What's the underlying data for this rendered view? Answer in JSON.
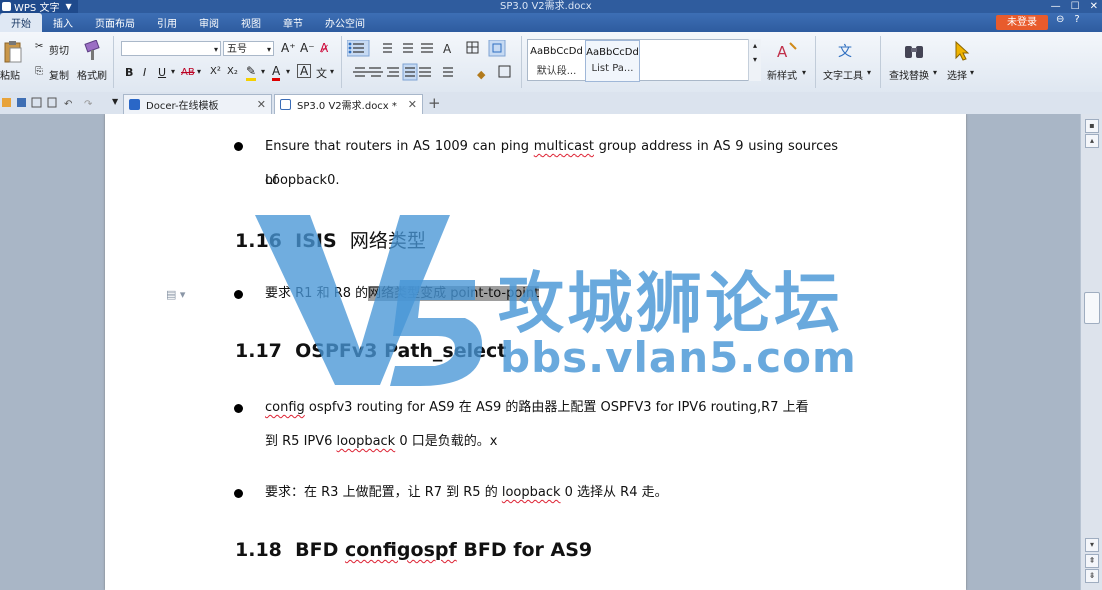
{
  "window": {
    "app_name": "WPS 文字",
    "doc_title": "SP3.0 V2需求.docx",
    "controls": [
      "—",
      "☐",
      "✕"
    ]
  },
  "menu": {
    "tabs": [
      "开始",
      "插入",
      "页面布局",
      "引用",
      "审阅",
      "视图",
      "章节",
      "办公空间"
    ],
    "active": "开始",
    "login_label": "未登录",
    "right_icons": [
      "⊖",
      "?"
    ]
  },
  "ribbon": {
    "paste": "粘贴",
    "cut": "剪切",
    "copy": "复制",
    "format_painter": "格式刷",
    "font_name": "",
    "font_size": "五号",
    "grow_font": "A⁺",
    "shrink_font": "A⁻",
    "clear_format": "A̷",
    "bold": "B",
    "italic": "I",
    "underline": "U",
    "strike": "AB",
    "superscript": "X²",
    "subscript": "X₂",
    "font_color": "A",
    "char_border": "A",
    "pinyin": "文",
    "styles": [
      {
        "sample": "AaBbCcDd",
        "name": "默认段..."
      },
      {
        "sample": "AaBbCcDd",
        "name": "List Pa..."
      }
    ],
    "new_style": "新样式",
    "text_tools": "文字工具",
    "find_replace": "查找替换",
    "select": "选择"
  },
  "tabs": [
    {
      "label": "Docer-在线模板",
      "active": false
    },
    {
      "label": "SP3.0 V2需求.docx *",
      "active": true
    }
  ],
  "document": {
    "p1_line1_pre": "Ensure that routers in AS 1009 can ping ",
    "p1_sq": "multicast",
    "p1_line1_post": " group address in AS 9 using sources of",
    "p1_line2": "Loopback0.",
    "h116_num": "1.16",
    "h116_en": "ISIS",
    "h116_cn": "网络类型",
    "p2_pre": "要求 R1 和 R8 的",
    "p2_sel": "网络类型变成 point-to-point",
    "h117_num": "1.17",
    "h117_text": "OSPFv3 Path_select",
    "p3_sq1": "config",
    "p3_line1": " ospfv3 routing for AS9  在  AS9  的路由器上配置  OSPFV3 for IPV6 routing,R7  上看",
    "p3_line2_pre": "到 R5 IPV6 ",
    "p3_sq2": "loopback",
    "p3_line2_post": " 0  口是负载的。x",
    "p4_pre": "要求：在 R3  上做配置，让  R7  到 R5  的  ",
    "p4_sq": "loopback",
    "p4_post": " 0  选择从 R4 走。",
    "h118_num": "1.18",
    "h118_pre": "BFD ",
    "h118_sq": "configospf",
    "h118_post": " BFD for AS9"
  },
  "watermark": {
    "cn": "攻城狮论坛",
    "url": "bbs.vlan5.com",
    "color": "#4896d6"
  }
}
